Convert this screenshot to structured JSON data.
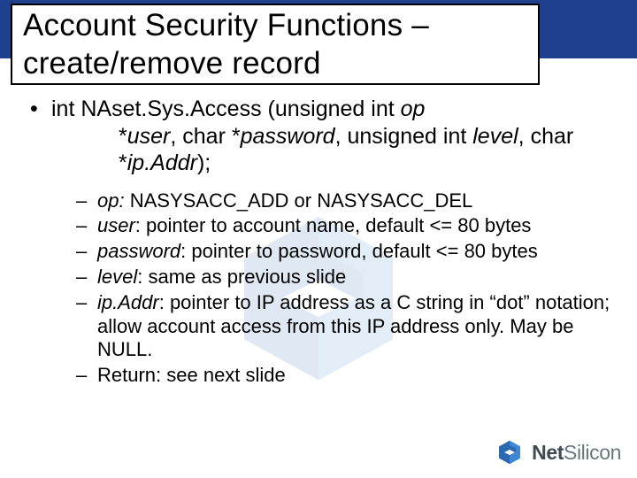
{
  "title_line1": "Account Security Functions –",
  "title_line2": "create/remove record",
  "signature": {
    "prefix": "int NAset.Sys.Access (unsigned int ",
    "p1": "op",
    "sep1": ", char *",
    "p2": "user",
    "sep2": ", char *",
    "p3": "password",
    "sep3": ", unsigned int ",
    "p4": "level",
    "sep4": ", char *",
    "p5": "ip.Addr",
    "suffix": ");"
  },
  "params": [
    {
      "name": "op:",
      "desc": " NASYSACC_ADD or NASYSACC_DEL"
    },
    {
      "name": "user",
      "desc": ": pointer to account name, default <= 80 bytes"
    },
    {
      "name": "password",
      "desc": ": pointer to password, default <= 80 bytes"
    },
    {
      "name": "level",
      "desc": ":  same as previous slide"
    },
    {
      "name": "ip.Addr",
      "desc": ": pointer to IP address as a C string in “dot” notation;  allow account access from this IP address only.  May be NULL."
    },
    {
      "name": "",
      "desc": "Return: see next slide"
    }
  ],
  "brand": {
    "part1": "Net",
    "part2": "Silicon"
  }
}
